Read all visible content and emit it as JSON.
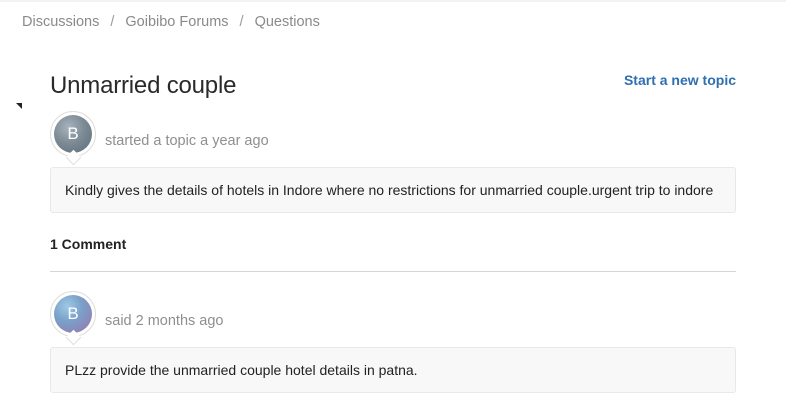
{
  "breadcrumb": {
    "items": [
      "Discussions",
      "Goibibo Forums",
      "Questions"
    ],
    "separator": "/"
  },
  "topic": {
    "title": "Unmarried couple",
    "new_topic_label": "Start a new topic",
    "author_initial": "B",
    "meta": "started a topic a year ago",
    "body": "Kindly gives the details of hotels in Indore where no restrictions for unmarried couple.urgent trip to indore"
  },
  "comments": {
    "heading": "1 Comment",
    "items": [
      {
        "author_initial": "B",
        "meta": "said 2 months ago",
        "body": "PLzz provide the unmarried couple hotel details in patna."
      }
    ]
  },
  "colors": {
    "link": "#2f6fb0",
    "muted_text": "#8f8f8f",
    "bubble_bg": "#f8f8f8"
  }
}
